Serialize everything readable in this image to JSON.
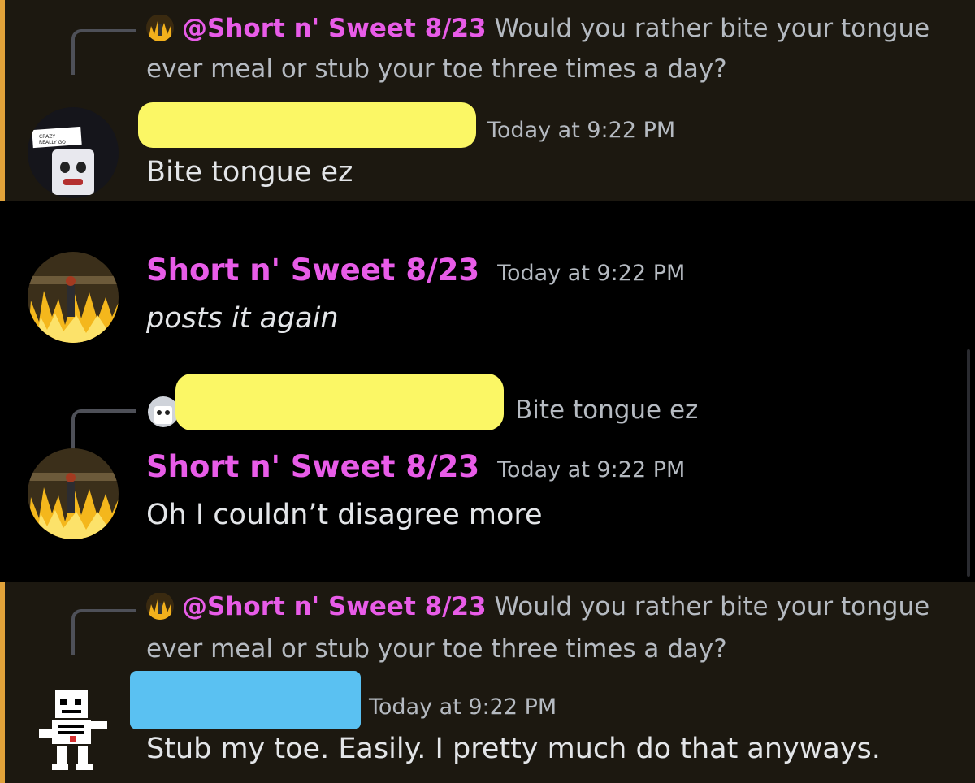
{
  "messages": [
    {
      "reply_mention": "@Short n' Sweet 8/23",
      "reply_text": "Would you rather bite your tongue",
      "reply_text_cont": "ever meal or stub your toe three times a day?",
      "timestamp": "Today at 9:22 PM",
      "content": "Bite tongue ez"
    },
    {
      "author": "Short n' Sweet 8/23",
      "timestamp": "Today at 9:22 PM",
      "content": "posts it again"
    },
    {
      "reply_text": "Bite tongue ez",
      "author": "Short n' Sweet 8/23",
      "timestamp": "Today at 9:22 PM",
      "content": "Oh I couldn’t disagree more"
    },
    {
      "reply_mention": "@Short n' Sweet 8/23",
      "reply_text": "Would you rather bite your tongue",
      "reply_text_cont": "ever meal or stub your toe three times a day?",
      "timestamp": "Today at 9:22 PM",
      "content": "Stub my toe. Easily. I pretty much do that anyways."
    }
  ],
  "colors": {
    "mention": "#e85ce8",
    "highlight_bar": "#e0a23a",
    "highlight_bg": "#1c1810",
    "redact_yellow": "#fbf765",
    "redact_blue": "#5ac1f2"
  },
  "icons": [
    "fire-avatar-icon",
    "toaster-avatar-icon",
    "skeleton-avatar-icon"
  ]
}
